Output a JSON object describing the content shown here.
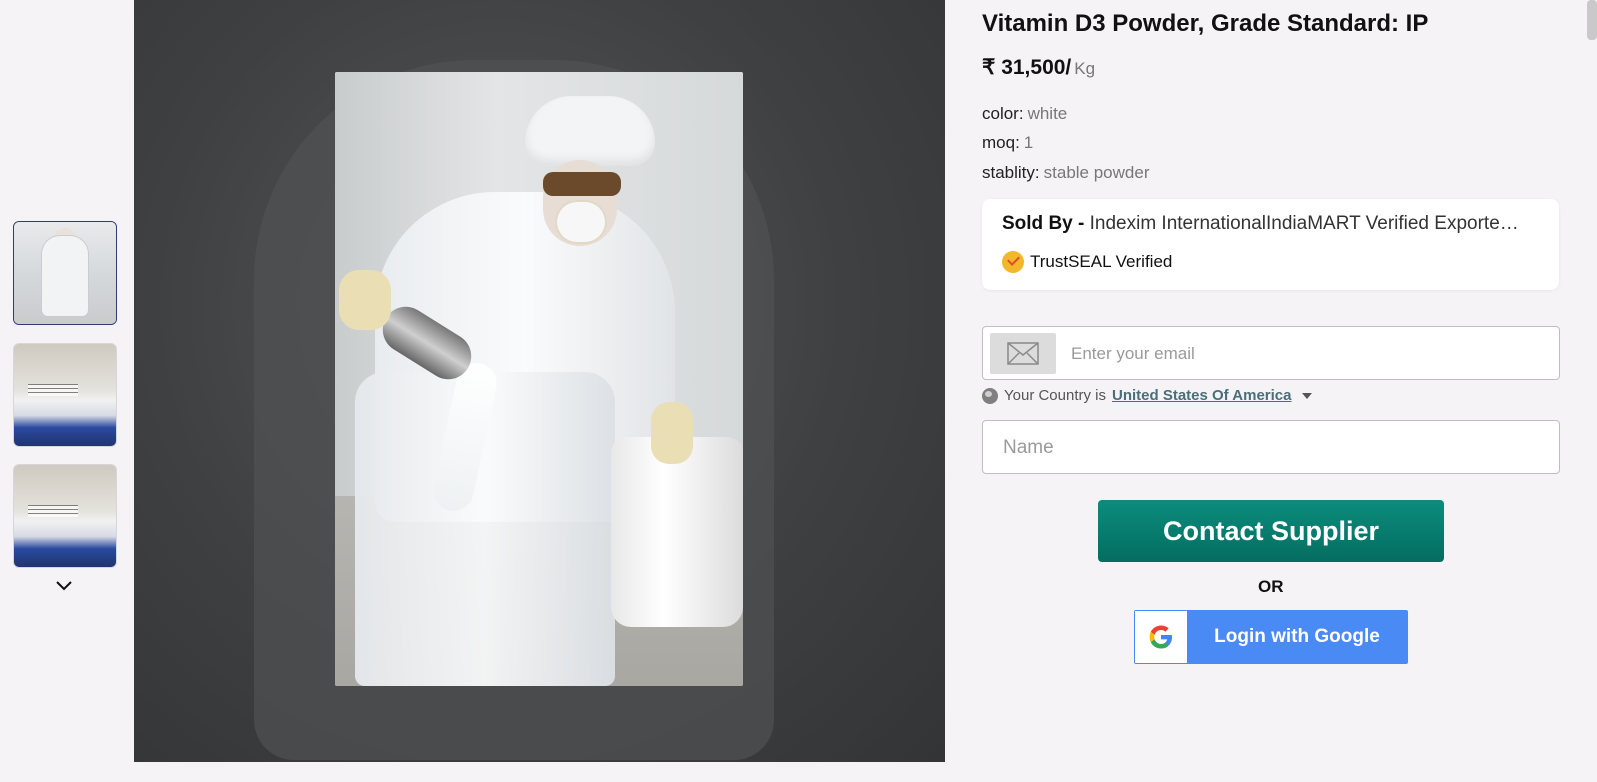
{
  "product": {
    "title": "Vitamin D3 Powder, Grade Standard: IP",
    "price": "₹ 31,500/",
    "price_unit": "Kg",
    "attributes": [
      {
        "label": "color:",
        "value": "white"
      },
      {
        "label": "moq:",
        "value": "1"
      },
      {
        "label": "stablity:",
        "value": "stable powder"
      }
    ]
  },
  "seller": {
    "sold_by_label": "Sold By -",
    "name": "Indexim InternationalIndiaMART Verified Exporte…",
    "trust": "TrustSEAL Verified"
  },
  "form": {
    "email_placeholder": "Enter your email",
    "country_prefix": "Your Country is",
    "country": "United States Of America",
    "name_placeholder": "Name",
    "contact_label": "Contact Supplier",
    "or_label": "OR",
    "google_label": "Login with Google"
  },
  "colors": {
    "contact_button": "#0c8c7d",
    "google_button": "#4a8af4",
    "country_link": "#4a6f78"
  },
  "icons": [
    "chevron-down-icon",
    "mail-icon",
    "globe-icon",
    "trustseal-icon",
    "google-g-icon",
    "caret-down-icon"
  ]
}
